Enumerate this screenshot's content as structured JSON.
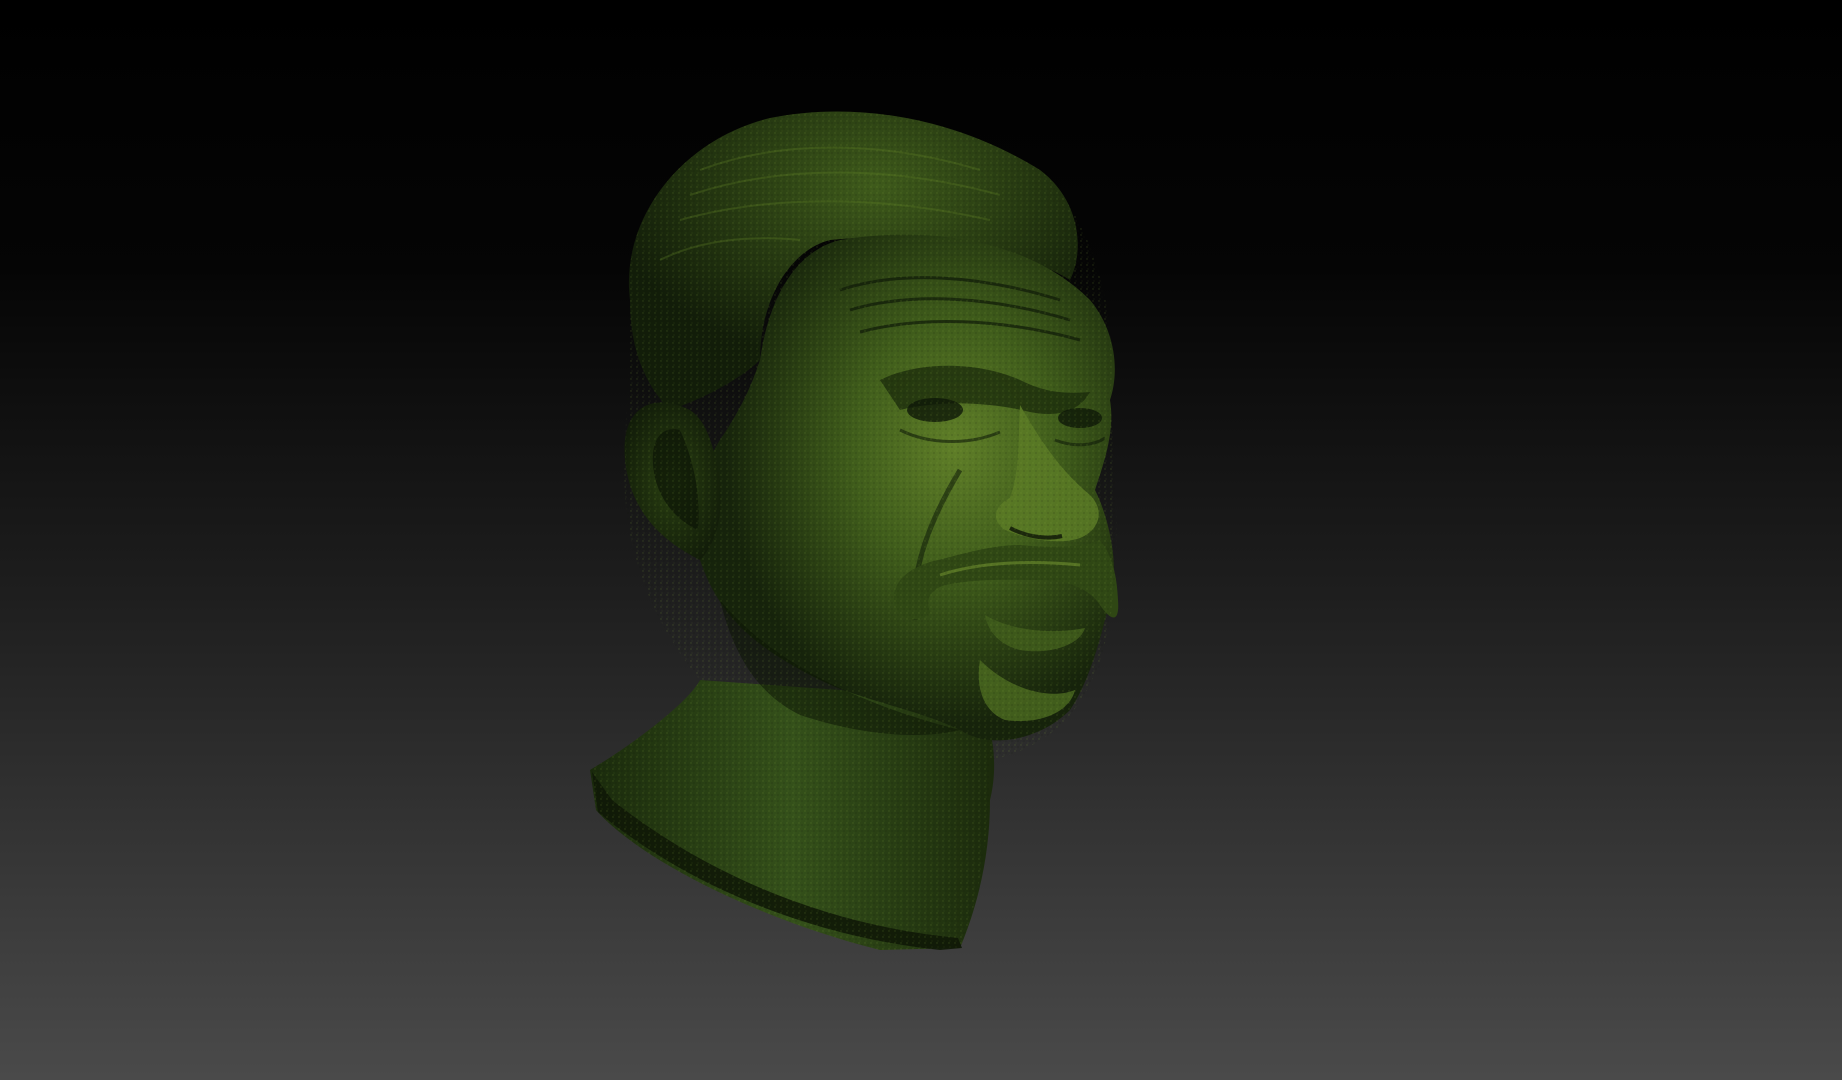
{
  "viewport": {
    "background_top": "#000000",
    "background_bottom": "#4a4a4a"
  },
  "model": {
    "subject": "sculpted-male-head-bust-with-mustache",
    "material_base": "#3d5a1c",
    "material_highlight": "#6f8f2e",
    "material_shadow": "#0e1708"
  }
}
